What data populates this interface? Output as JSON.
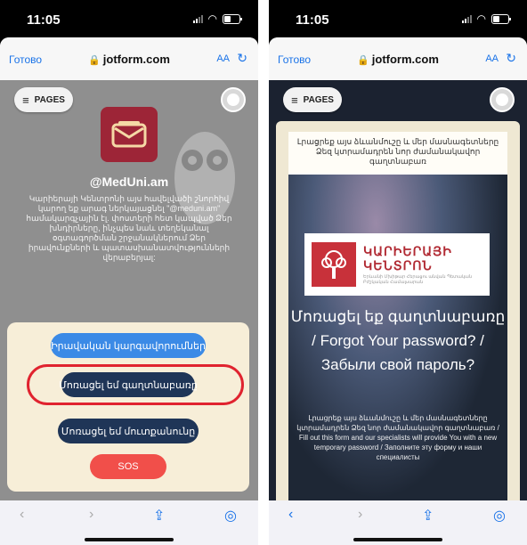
{
  "status": {
    "time": "11:05"
  },
  "browser": {
    "done_left": "Готово",
    "done_right": "Готово",
    "domain": "jotform.com",
    "text_size": "AA"
  },
  "left": {
    "pages_label": "PAGES",
    "handle": "@MedUni.am",
    "description": "Կարիերայի Կենտրոնի այս հավելվածի շնորհիվ կարող եք արագ ներկայացնել \"@meduni.am\" համակարգչային էլ. փոստերի հետ կապված Ձեր խնդիրները, ինչպես նաև տեղեկանալ օգտագործման շրջանակներում Ձեր իրավունքների և պատասխանատվությունների վերաբերյալ:",
    "buttons": [
      "Իրավական կարգավորումներ",
      "Մոռացել եմ գաղտնաբառը",
      "Մոռացել եմ մուտքանունը",
      "SOS"
    ]
  },
  "right": {
    "pages_label": "PAGES",
    "header_text": "Լրացրեք այս ձևանմուշը և մեր մասնագետները Ձեզ կտրամադրեն նոր ժամանակավոր գաղտնաբառ",
    "logo_name_1": "ԿԱՐԻԵՐԱՅԻ",
    "logo_name_2": "ԿԵՆՏՐՈՆ",
    "logo_sub": "Երևանի Մխիթար Հերացու անվան Պետական Բժշկական Համալսարան",
    "title": "Մոռացել եք գաղտնաբառը / Forgot Your password? / Забыли свой пароль?",
    "body": "Լրացրեք այս ձևանմուշը և մեր մասնագետները կտրամադրեն Ձեզ նոր ժամանակավոր գաղտնաբառ / Fill out this form and our specialists will provide You with a new temporary password / Заполните эту форму и наши специалисты"
  },
  "colors": {
    "link_blue": "#1a73e8",
    "logo_red": "#9d2537",
    "button_blue": "#3b8ae6",
    "button_navy": "#1f3557",
    "button_red": "#f14f4a",
    "highlight": "#e0232f"
  },
  "icons": [
    "lock-icon",
    "reload-icon",
    "menu-icon",
    "profile-icon",
    "mail-icon",
    "tree-icon",
    "back-icon",
    "forward-icon",
    "share-icon",
    "compass-icon"
  ]
}
